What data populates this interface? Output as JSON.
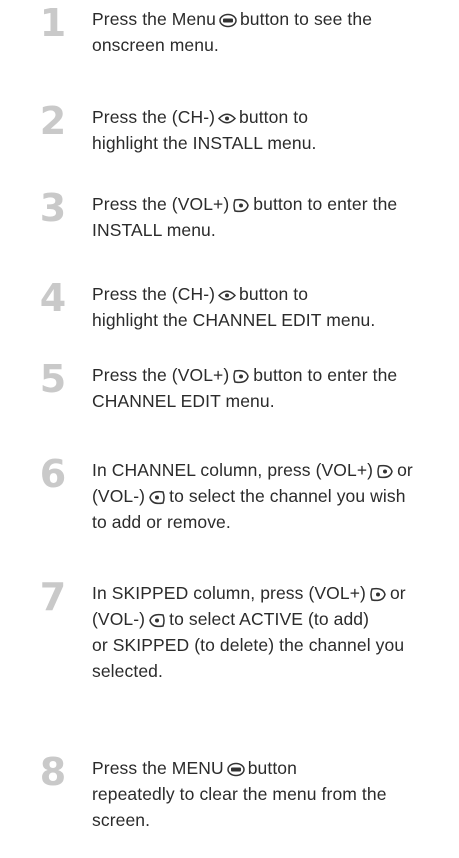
{
  "steps": [
    {
      "num": "1",
      "l1a": "Press the Menu",
      "l1b": "button to see the",
      "l2": "onscreen menu.",
      "icon": "menu-button-icon"
    },
    {
      "num": "2",
      "l1a": "Press the (CH-)",
      "l1b": "button to",
      "l2": "highlight the INSTALL menu.",
      "icon": "ch-minus-button-icon"
    },
    {
      "num": "3",
      "l1a": "Press the (VOL+)",
      "l1b": "button to enter the",
      "l2": "INSTALL menu.",
      "icon": "vol-plus-button-icon"
    },
    {
      "num": "4",
      "l1a": "Press the (CH-)",
      "l1b": "button to",
      "l2": "highlight the CHANNEL EDIT menu.",
      "icon": "ch-minus-button-icon"
    },
    {
      "num": "5",
      "l1a": "Press the (VOL+)",
      "l1b": "button to enter the",
      "l2": "CHANNEL EDIT menu.",
      "icon": "vol-plus-button-icon"
    },
    {
      "num": "6",
      "l1a": "In CHANNEL column, press (VOL+)",
      "l1b": "or",
      "l2a": "(VOL-)",
      "l2b": "to select the channel you wish",
      "l3": "to add or remove.",
      "icon": "vol-plus-button-icon",
      "icon2": "vol-minus-button-icon"
    },
    {
      "num": "7",
      "l1a": "In SKIPPED column, press (VOL+)",
      "l1b": "or",
      "l2a": "(VOL-)",
      "l2b": "to select ACTIVE (to add)",
      "l3": "or SKIPPED (to delete) the channel you",
      "l4": "selected.",
      "icon": "vol-plus-button-icon",
      "icon2": "vol-minus-button-icon"
    },
    {
      "num": "8",
      "l1a": "Press the MENU",
      "l1b": "button",
      "l2": "repeatedly to clear the menu from the",
      "l3": "screen.",
      "icon": "menu-button-icon"
    }
  ]
}
